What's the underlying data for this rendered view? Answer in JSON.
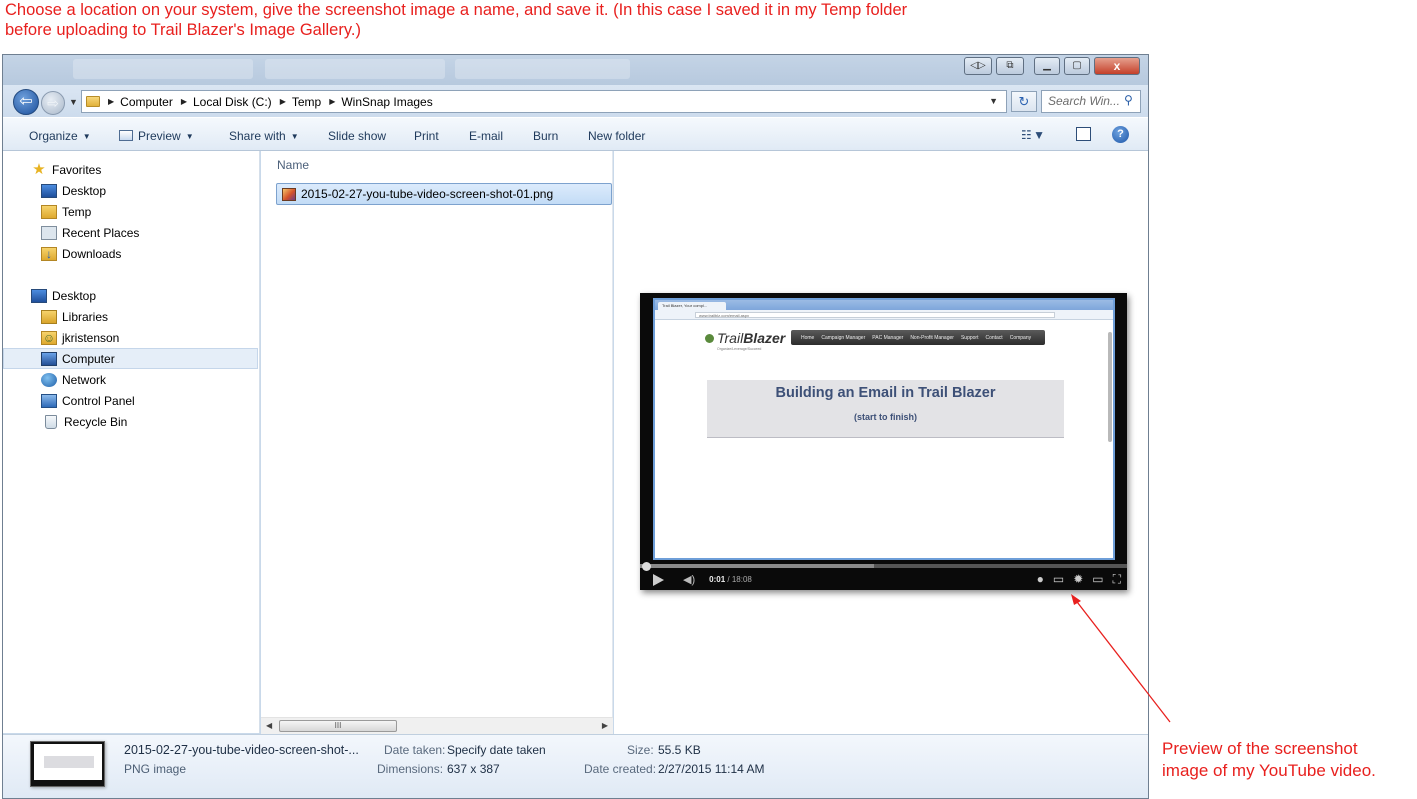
{
  "annotations": {
    "top_line1": "Choose a location on your system, give the screenshot image a name, and save it.  (In this case I saved it in my Temp folder",
    "top_line2": "before uploading to Trail Blazer's Image Gallery.)",
    "right_line1": "Preview of the screenshot",
    "right_line2": "image of my YouTube video.",
    "color": "#e8201e"
  },
  "window": {
    "title_buttons": {
      "close": "x"
    }
  },
  "address_bar": {
    "crumbs": [
      "Computer",
      "Local Disk (C:)",
      "Temp",
      "WinSnap Images"
    ],
    "search_placeholder": "Search Win..."
  },
  "command_bar": {
    "organize": "Organize",
    "preview": "Preview",
    "share_with": "Share with",
    "slide_show": "Slide show",
    "print": "Print",
    "email": "E-mail",
    "burn": "Burn",
    "new_folder": "New folder"
  },
  "nav_pane": {
    "favorites_header": "Favorites",
    "favorites": [
      "Desktop",
      "Temp",
      "Recent Places",
      "Downloads"
    ],
    "desktop_header": "Desktop",
    "desktop_items": [
      "Libraries",
      "jkristenson",
      "Computer",
      "Network",
      "Control Panel",
      "Recycle Bin"
    ],
    "selected": "Computer"
  },
  "file_list": {
    "column_name": "Name",
    "files": [
      {
        "name": "2015-02-27-you-tube-video-screen-shot-01.png",
        "selected": true
      }
    ],
    "scroll_grip": "III"
  },
  "preview": {
    "browser_tab": "Trail Blazer, Your compl...",
    "browser_url": "www.trailblz.com/email.aspx",
    "logo_light": "Trail",
    "logo_bold": "Blazer",
    "tagline": "Organize/Leverage/Succeed",
    "menu": [
      "Home",
      "Campaign Manager",
      "PAC Manager",
      "Non-Profit Manager",
      "Support",
      "Contact",
      "Company"
    ],
    "banner_title": "Building an Email in Trail Blazer",
    "banner_subtitle": "(start to finish)",
    "time_current": "0:01",
    "time_total": "/ 18:08",
    "progress_fraction": 0.002,
    "buffered_fraction": 0.48
  },
  "details": {
    "name": "2015-02-27-you-tube-video-screen-shot-...",
    "type": "PNG image",
    "date_taken_label": "Date taken:",
    "date_taken_value": "Specify date taken",
    "dimensions_label": "Dimensions:",
    "dimensions_value": "637 x 387",
    "size_label": "Size:",
    "size_value": "55.5 KB",
    "date_created_label": "Date created:",
    "date_created_value": "2/27/2015 11:14 AM"
  }
}
